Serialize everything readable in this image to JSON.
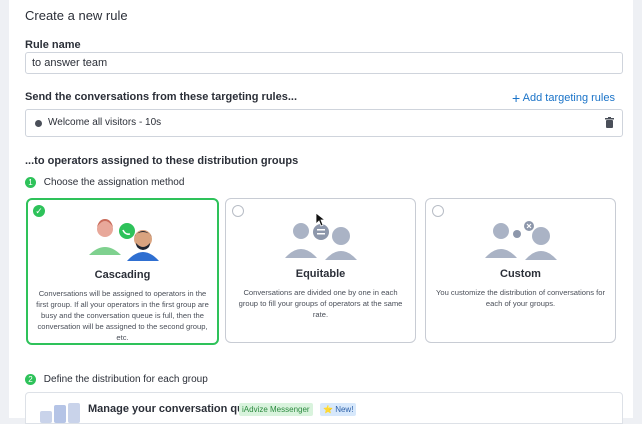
{
  "page": {
    "title": "Create a new rule"
  },
  "rule_name": {
    "label": "Rule name",
    "value": "to answer team"
  },
  "targeting": {
    "label": "Send the conversations from these targeting rules...",
    "add_link": "Add targeting rules",
    "rule_item": "Welcome all visitors - 10s"
  },
  "distribution": {
    "label": "...to operators assigned to these distribution groups"
  },
  "step1": {
    "number": "1",
    "label": "Choose the assignation method"
  },
  "methods": [
    {
      "title": "Cascading",
      "description": "Conversations will be assigned to operators in the first group. If all your operators in the first group are busy and the conversation queue is full, then the conversation will be assigned to the second group, etc.",
      "selected": true
    },
    {
      "title": "Equitable",
      "description": "Conversations are divided one by one in each group to fill your groups of operators at the same rate.",
      "selected": false
    },
    {
      "title": "Custom",
      "description": "You customize the distribution of conversations for each of your groups.",
      "selected": false
    }
  ],
  "step2": {
    "number": "2",
    "label": "Define the distribution for each group"
  },
  "queues": {
    "title": "Manage your conversation queues",
    "badge_messenger": "iAdvize Messenger",
    "badge_new": "New!"
  },
  "colors": {
    "accent_green": "#2ec25a",
    "link_blue": "#1a73c8"
  }
}
